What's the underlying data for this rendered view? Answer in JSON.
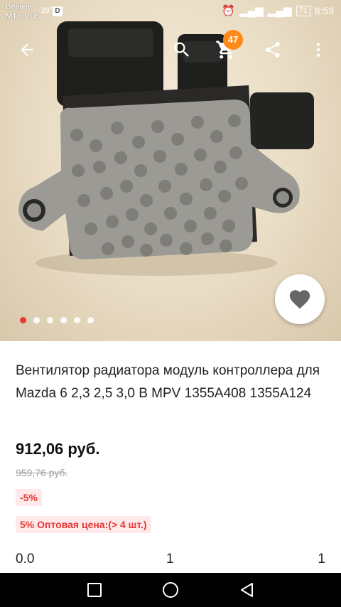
{
  "status_bar": {
    "carrier_line1": "Beeline",
    "carrier_line2": "MTS RUS",
    "temperature": "-29°",
    "d_badge": "D",
    "battery": "71",
    "time": "8:59"
  },
  "toolbar": {
    "back_icon": "arrow-left-icon",
    "search_icon": "search-icon",
    "cart_icon": "cart-icon",
    "cart_count": "47",
    "share_icon": "share-icon",
    "more_icon": "more-vert-icon"
  },
  "gallery": {
    "dots_total": 6,
    "active_index": 0,
    "favorite_icon": "heart-icon"
  },
  "product": {
    "title": "Вентилятор радиатора модуль контроллера для Mazda 6 2,3 2,5 3,0 В MPV 1355A408 1355A124",
    "price": "912,06 руб.",
    "old_price": "959,76 руб.",
    "discount": "-5%",
    "wholesale": "5%  Оптовая цена:(> 4 шт.)",
    "stats": [
      "0.0",
      "1",
      "1"
    ]
  },
  "colors": {
    "accent_red": "#e53935",
    "badge_orange": "#ff8a1a",
    "tag_bg": "#ffe9eb"
  },
  "nav": {
    "recents_icon": "square-icon",
    "home_icon": "circle-icon",
    "back_icon": "triangle-back-icon"
  }
}
